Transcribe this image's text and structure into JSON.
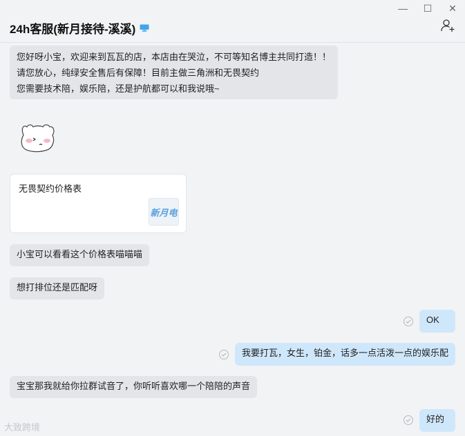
{
  "window": {
    "controls": {
      "minimize": "—",
      "maximize": "☐",
      "close": "✕"
    }
  },
  "header": {
    "title": "24h客服(新月接待-溪溪)",
    "device_icon": "monitor-icon",
    "add_member_icon": "add-user-icon"
  },
  "messages": {
    "welcome": {
      "line1": "您好呀小宝，欢迎来到瓦瓦的店，本店由在哭泣，不可等知名博主共同打造！！",
      "line2": "请您放心，纯绿安全售后有保障！目前主做三角洲和无畏契约",
      "line3": "您需要技术陪，娱乐陪，还是护航都可以和我说哦~"
    },
    "card_title": "无畏契约价格表",
    "card_thumb_text": "新月电",
    "msg_look": "小宝可以看看这个价格表喵喵喵",
    "msg_rank": "想打排位还是匹配呀",
    "msg_ok": "OK",
    "msg_request": "我要打瓦，女生，铂金，话多一点活泼一点的娱乐配",
    "msg_group": "宝宝那我就给你拉群试音了，你听听喜欢哪一个陪陪的声音",
    "msg_good": "好的"
  },
  "watermark": "大致跨境",
  "colors": {
    "background": "#f2f3f5",
    "bubble_other": "#e3e5e9",
    "bubble_self": "#cfe7fb"
  }
}
